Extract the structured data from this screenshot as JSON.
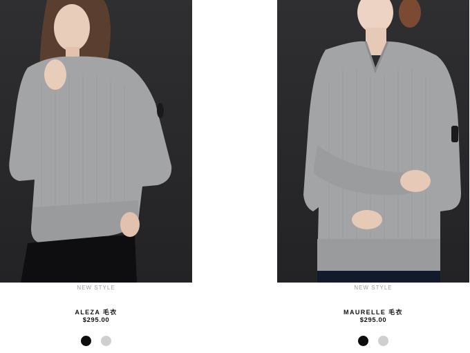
{
  "products": [
    {
      "tag": "NEW STYLE",
      "name": "ALEZA 毛衣",
      "price": "$295.00",
      "swatches": [
        {
          "label": "black",
          "color": "#0d0d0d"
        },
        {
          "label": "grey",
          "color": "#cfcfd1"
        }
      ]
    },
    {
      "tag": "NEW STYLE",
      "name": "MAURELLE 毛衣",
      "price": "$295.00",
      "swatches": [
        {
          "label": "black",
          "color": "#0d0d0d"
        },
        {
          "label": "grey",
          "color": "#cfcfd1"
        }
      ]
    }
  ],
  "colors": {
    "photo_background": "#2a2a2c",
    "sweater": "#a3a4a6"
  }
}
